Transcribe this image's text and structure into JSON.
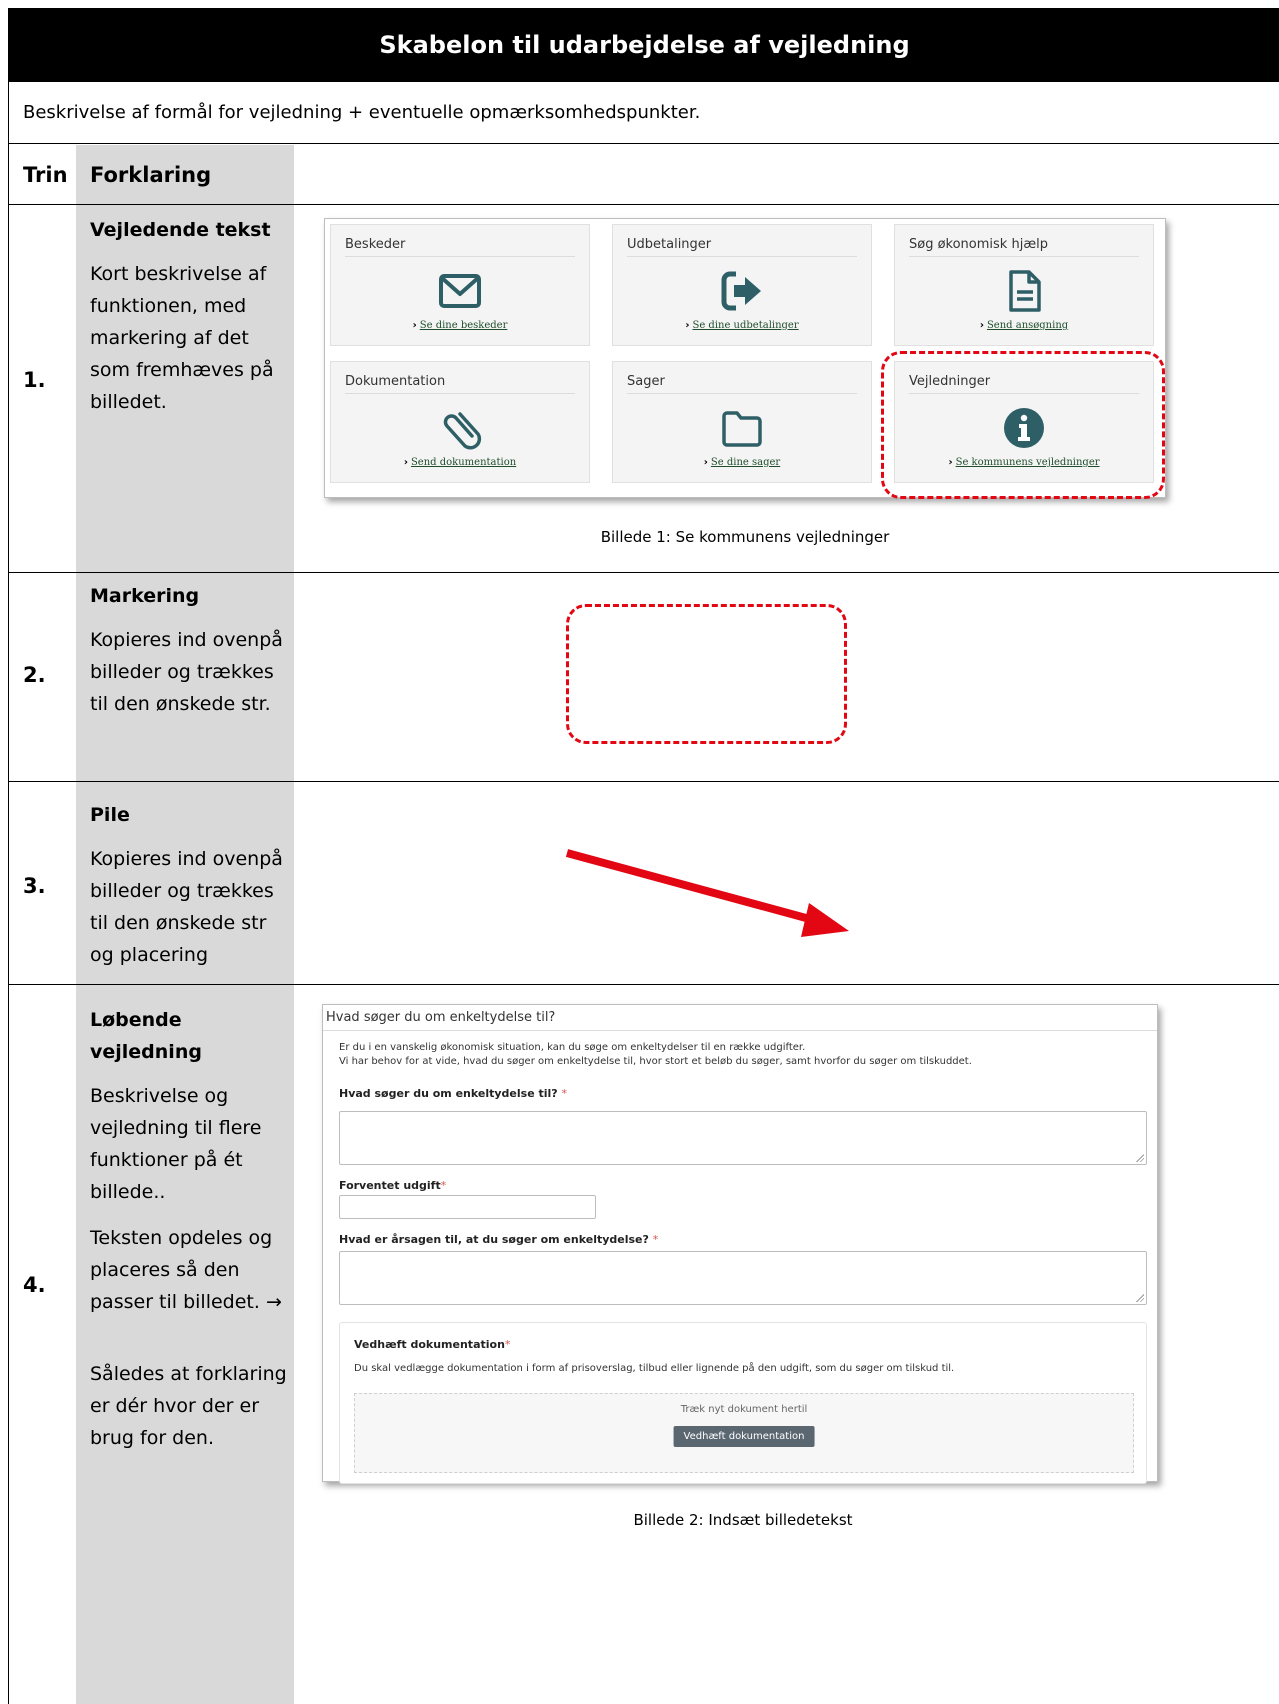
{
  "document": {
    "title": "Skabelon til udarbejdelse af vejledning",
    "description": "Beskrivelse af formål for vejledning + eventuelle opmærksomhedspunkter."
  },
  "table_header": {
    "col_step": "Trin",
    "col_explanation": "Forklaring"
  },
  "steps": [
    {
      "number": "1.",
      "title": "Vejledende tekst",
      "paragraphs": [
        "Kort beskrivelse af funktionen, med markering af det som fremhæves på billedet."
      ]
    },
    {
      "number": "2.",
      "title": "Markering",
      "paragraphs": [
        "Kopieres ind ovenpå billeder og trækkes til den ønskede str."
      ]
    },
    {
      "number": "3.",
      "title": "Pile",
      "paragraphs": [
        "Kopieres ind ovenpå billeder og trækkes til den ønskede str og placering"
      ]
    },
    {
      "number": "4.",
      "title": "Løbende vejledning",
      "paragraphs": [
        "Beskrivelse og vejledning til flere funktioner på ét billede..",
        "Teksten opdeles og placeres så den passer til billedet. →",
        "Således at forklaring er dér hvor der er brug for den."
      ]
    }
  ],
  "screenshot1": {
    "tiles": [
      {
        "title": "Beskeder",
        "link": "Se dine beskeder",
        "icon": "envelope-icon"
      },
      {
        "title": "Udbetalinger",
        "link": "Se dine udbetalinger",
        "icon": "sign-out-icon"
      },
      {
        "title": "Søg økonomisk hjælp",
        "link": "Send ansøgning",
        "icon": "document-icon"
      },
      {
        "title": "Dokumentation",
        "link": "Send dokumentation",
        "icon": "paperclip-icon"
      },
      {
        "title": "Sager",
        "link": "Se dine sager",
        "icon": "folder-icon"
      },
      {
        "title": "Vejledninger",
        "link": "Se kommunens vejledninger",
        "icon": "info-icon"
      }
    ],
    "caption": "Billede 1: Se kommunens vejledninger"
  },
  "screenshot2": {
    "header": "Hvad søger du om enkeltydelse til?",
    "intro_line1": "Er du i en vanskelig økonomisk situation, kan du søge om enkeltydelser til en række udgifter.",
    "intro_line2": "Vi har behov for at vide, hvad du søger om enkeltydelse til, hvor stort et beløb du søger, samt hvorfor du søger om tilskuddet.",
    "field1_label": "Hvad søger du om enkeltydelse til?",
    "field2_label": "Forventet udgift",
    "field3_label": "Hvad er årsagen til, at du søger om enkeltydelse?",
    "required_mark": "*",
    "attach_title": "Vedhæft dokumentation",
    "attach_desc": "Du skal vedlægge dokumentation i form af prisoverslag, tilbud eller lignende på den udgift, som du søger om tilskud til.",
    "dropzone_text": "Træk nyt dokument hertil",
    "attach_button": "Vedhæft dokumentation",
    "caption": "Billede 2: Indsæt billedetekst"
  },
  "colors": {
    "highlight": "#e30613",
    "arrow": "#e30613",
    "icon": "#2f5f66",
    "gray_column": "#d9d9d9"
  }
}
